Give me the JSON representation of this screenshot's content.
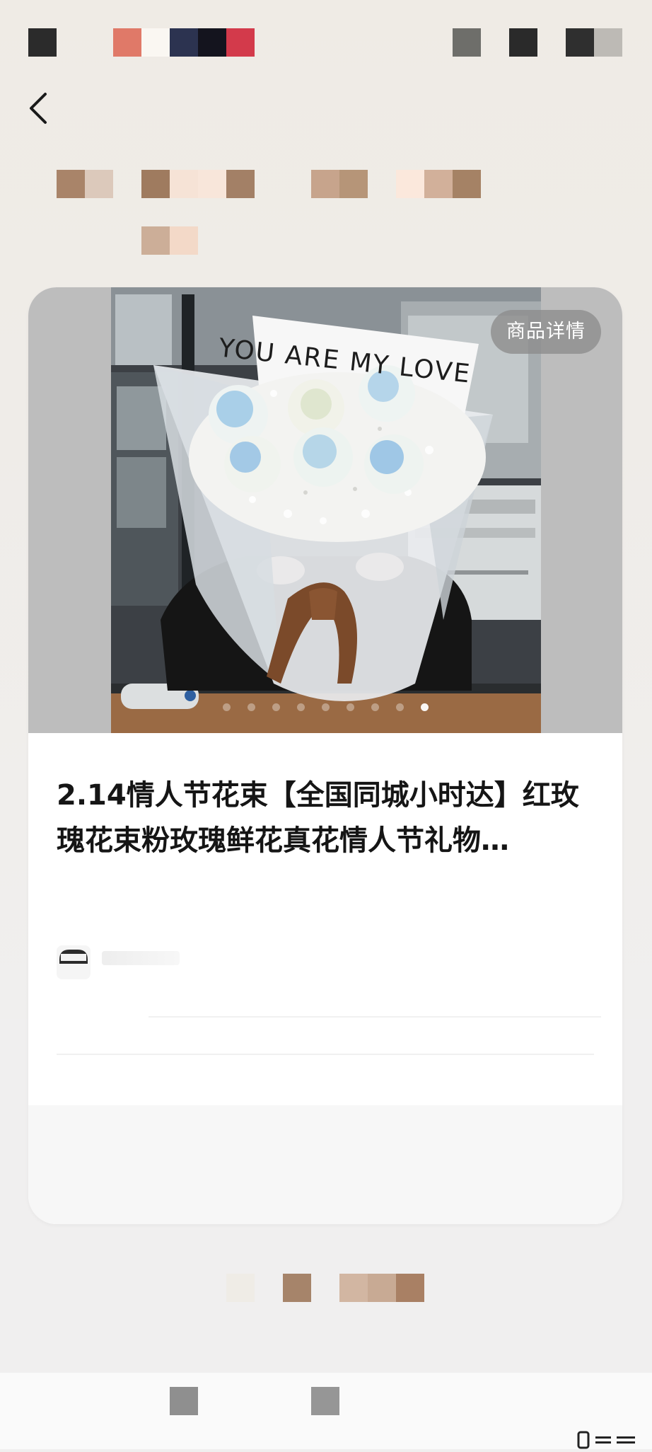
{
  "product": {
    "detail_button_label": "商品详情",
    "title": "2.14情人节花束【全国同城小时达】红玫瑰花束粉玫瑰鲜花真花情人节礼物…",
    "image_caption": "YOU ARE MY LOVE",
    "carousel": {
      "total_images": 9,
      "active_index": 8
    }
  },
  "colors": {
    "page_bg": "#f0efef",
    "card_bg": "#ffffff",
    "title_text": "#151515",
    "pill_bg": "#8c8c8c"
  },
  "icons": {
    "back": "chevron-left-icon",
    "nav": "gesture-handle-icon"
  }
}
